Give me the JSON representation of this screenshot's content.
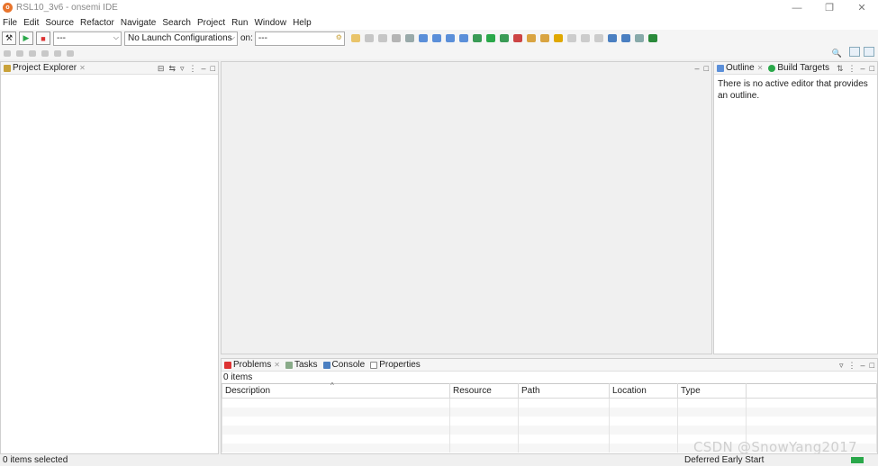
{
  "window": {
    "title": "RSL10_3v6 - onsemi IDE",
    "logo_letter": "o"
  },
  "menu": [
    "File",
    "Edit",
    "Source",
    "Refactor",
    "Navigate",
    "Search",
    "Project",
    "Run",
    "Window",
    "Help"
  ],
  "toolbar": {
    "launch_mode_value": "---",
    "launch_config_value": "No Launch Configurations",
    "target_label": "on:",
    "target_value": "---"
  },
  "project_explorer": {
    "title": "Project Explorer"
  },
  "outline": {
    "tab_outline": "Outline",
    "tab_build": "Build Targets",
    "message": "There is no active editor that provides an outline."
  },
  "bottom": {
    "tabs": [
      "Problems",
      "Tasks",
      "Console",
      "Properties"
    ],
    "count": "0 items",
    "columns": [
      "Description",
      "Resource",
      "Path",
      "Location",
      "Type"
    ]
  },
  "status": {
    "left": "0 items selected",
    "right": "Deferred Early Start"
  },
  "watermark": "CSDN @SnowYang2017",
  "colors": {
    "accent": "#e8742c",
    "progress": "#2aa84a"
  }
}
